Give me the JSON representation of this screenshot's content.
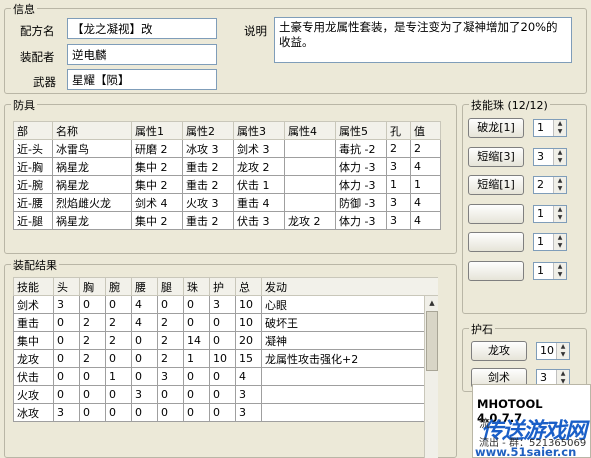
{
  "info": {
    "title": "信息",
    "recipe_label": "配方名",
    "recipe_value": "【龙之凝视】改",
    "equipper_label": "装配者",
    "equipper_value": "逆电麟",
    "weapon_label": "武器",
    "weapon_value": "星耀【陨】",
    "desc_label": "说明",
    "desc_value": "土豪专用龙属性套装，是专注变为了凝神增加了20%的收益。"
  },
  "armor": {
    "title": "防具",
    "headers": [
      "部",
      "名称",
      "属性1",
      "属性2",
      "属性3",
      "属性4",
      "属性5",
      "孔",
      "值"
    ],
    "rows": [
      [
        "近-头",
        "冰雷鸟",
        "研磨 2",
        "冰攻 3",
        "剑术 3",
        "",
        "毒抗 -2",
        "2",
        "2"
      ],
      [
        "近-胸",
        "祸星龙",
        "集中 2",
        "重击 2",
        "龙攻 2",
        "",
        "体力 -3",
        "3",
        "4"
      ],
      [
        "近-腕",
        "祸星龙",
        "集中 2",
        "重击 2",
        "伏击 1",
        "",
        "体力 -3",
        "1",
        "1"
      ],
      [
        "近-腰",
        "烈焰雌火龙",
        "剑术 4",
        "火攻 3",
        "重击 4",
        "",
        "防御 -3",
        "3",
        "4"
      ],
      [
        "近-腿",
        "祸星龙",
        "集中 2",
        "重击 2",
        "伏击 3",
        "龙攻 2",
        "体力 -3",
        "3",
        "4"
      ]
    ]
  },
  "result": {
    "title": "装配结果",
    "headers": [
      "技能",
      "头",
      "胸",
      "腕",
      "腰",
      "腿",
      "珠",
      "护",
      "总",
      "发动"
    ],
    "rows": [
      [
        "剑术",
        "3",
        "0",
        "0",
        "4",
        "0",
        "0",
        "3",
        "10",
        "心眼"
      ],
      [
        "重击",
        "0",
        "2",
        "2",
        "4",
        "2",
        "0",
        "0",
        "10",
        "破坏王"
      ],
      [
        "集中",
        "0",
        "2",
        "2",
        "0",
        "2",
        "14",
        "0",
        "20",
        "凝神"
      ],
      [
        "龙攻",
        "0",
        "2",
        "0",
        "0",
        "2",
        "1",
        "10",
        "15",
        "龙属性攻击强化+2"
      ],
      [
        "伏击",
        "0",
        "0",
        "1",
        "0",
        "3",
        "0",
        "0",
        "4",
        ""
      ],
      [
        "火攻",
        "0",
        "0",
        "0",
        "3",
        "0",
        "0",
        "0",
        "3",
        ""
      ],
      [
        "冰攻",
        "3",
        "0",
        "0",
        "0",
        "0",
        "0",
        "0",
        "3",
        ""
      ]
    ]
  },
  "jewels": {
    "title": "技能珠 (12/12)",
    "items": [
      {
        "label": "破龙[1]",
        "count": "1"
      },
      {
        "label": "短缩[3]",
        "count": "3"
      },
      {
        "label": "短缩[1]",
        "count": "2"
      },
      {
        "label": "",
        "count": "1"
      },
      {
        "label": "",
        "count": "1"
      },
      {
        "label": "",
        "count": "1"
      }
    ]
  },
  "charm": {
    "title": "护石",
    "items": [
      {
        "label": "龙攻",
        "value": "10"
      },
      {
        "label": "剑术",
        "value": "3"
      }
    ]
  },
  "watermark": {
    "app": "MHOTOOL 4.0.7.7",
    "site_name": "传送游戏网",
    "line1": "流",
    "line2": "流出 - 群：521365069",
    "url": "www.51saier.cn"
  }
}
